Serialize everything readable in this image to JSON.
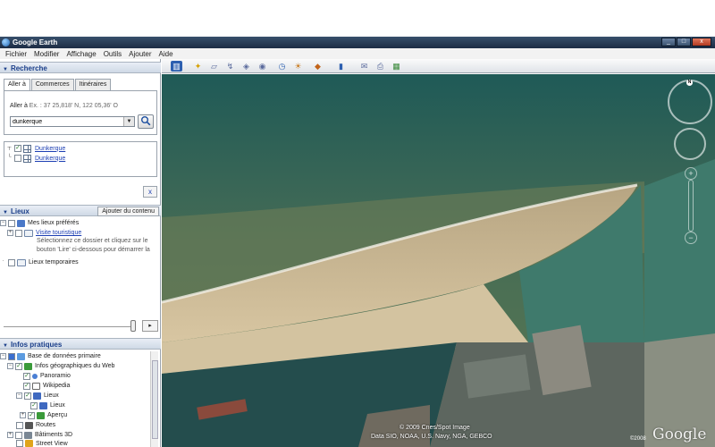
{
  "app": {
    "title": "Google Earth"
  },
  "window": {
    "minimize": "_",
    "maximize": "□",
    "close": "x"
  },
  "menubar": [
    "Fichier",
    "Modifier",
    "Affichage",
    "Outils",
    "Ajouter",
    "Aide"
  ],
  "search_panel": {
    "title": "Recherche",
    "tabs": [
      "Aller à",
      "Commerces",
      "Itinéraires"
    ],
    "goto_label": "Aller à",
    "goto_hint": "Ex. : 37 25,818' N, 122 05,36' O",
    "query": "dunkerque",
    "results": [
      {
        "label": "Dunkerque",
        "checked": true
      },
      {
        "label": "Dunkerque",
        "checked": false
      }
    ],
    "clear_label": "x"
  },
  "places_panel": {
    "title": "Lieux",
    "add_content": "Ajouter du contenu",
    "my_places": "Mes lieux préférés",
    "tour": "Visite touristique",
    "tour_note_1": "Sélectionnez ce dossier et cliquez sur le",
    "tour_note_2": "bouton 'Lire' ci-dessous pour démarrer la",
    "temp_places": "Lieux temporaires"
  },
  "layers_panel": {
    "title": "Infos pratiques",
    "items": [
      "Base de données primaire",
      "Infos géographiques du Web",
      "Panoramio",
      "Wikipedia",
      "Lieux",
      "Lieux",
      "Aperçu",
      "Routes",
      "Bâtiments 3D",
      "Street View"
    ]
  },
  "map": {
    "attribution_1": "© 2009 Cnes/Spot Image",
    "attribution_2": "Data SIO, NOAA, U.S. Navy, NGA, GEBCO",
    "logo": "Google",
    "logo_year": "©2008",
    "compass_letter": "N",
    "zoom_in": "+",
    "zoom_out": "−"
  },
  "colors": {
    "sea_deep": "#1f5a57",
    "sea_shallow": "#5d7a52",
    "beach": "#c9b48f",
    "harbor_water": "#3f7a6c",
    "city": "#6f6a5f",
    "panel_header_text": "#1b3f8a"
  }
}
